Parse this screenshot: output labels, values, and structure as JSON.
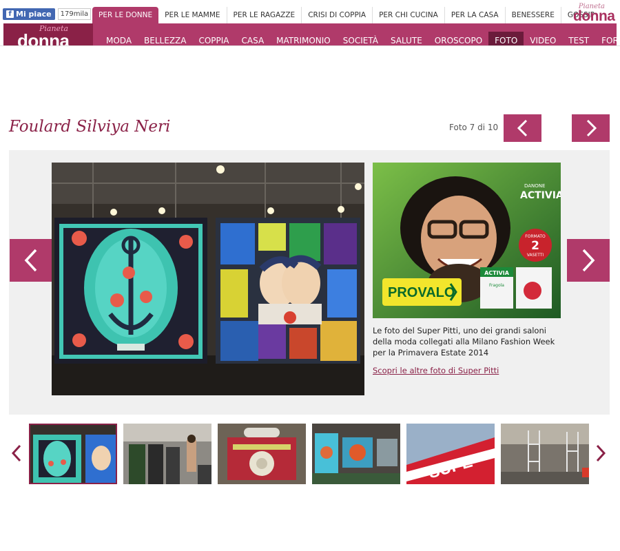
{
  "facebook": {
    "like_label": "Mi piace",
    "count": "179mila"
  },
  "sub_tabs": [
    "PER LE DONNE",
    "PER LE MAMME",
    "PER LE RAGAZZE",
    "CRISI DI COPPIA",
    "PER CHI CUCINA",
    "PER LA CASA",
    "BENESSERE",
    "GOSSIP"
  ],
  "logo": {
    "pianeta": "Pianeta",
    "donna": "donna"
  },
  "nav": [
    "MODA",
    "BELLEZZA",
    "COPPIA",
    "CASA",
    "MATRIMONIO",
    "SOCIETÀ",
    "SALUTE",
    "OROSCOPO",
    "FOTO",
    "VIDEO",
    "TEST",
    "FORUM"
  ],
  "nav_active": "FOTO",
  "gallery": {
    "title": "Foulard Silviya Neri",
    "counter": "Foto 7 di 10",
    "caption": "Le foto del Super Pitti, uno dei grandi saloni della moda collegati alla Milano Fashion Week per la Primavera Estate 2014",
    "more_link": "Scopri le altre foto di Super Pitti"
  },
  "ad": {
    "brand_top": "DANONE",
    "brand": "ACTIVIA",
    "badge_line1": "FORMATO",
    "badge_num": "2",
    "badge_line2": "VASETTI",
    "cta": "PROVALO",
    "cup_label": "ACTIVIA",
    "cup_flavor": "Fragola"
  },
  "thumb_banner_text": "SUPE",
  "colors": {
    "brand": "#b03a6a",
    "brand_dark": "#8a2147",
    "nav_active": "#6b1b3b"
  }
}
